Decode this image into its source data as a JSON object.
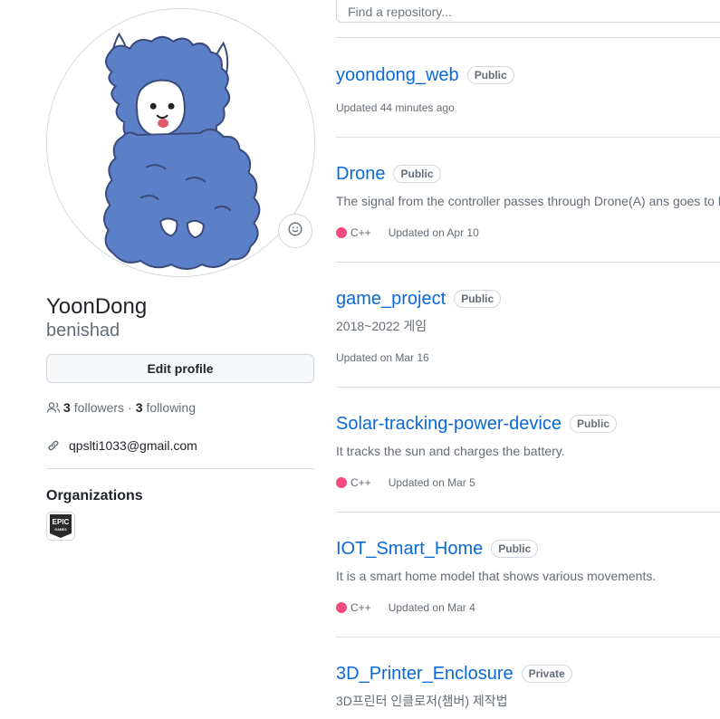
{
  "profile": {
    "display_name": "YoonDong",
    "username": "benishad",
    "edit_label": "Edit profile",
    "followers_count": "3",
    "followers_label": "followers",
    "separator": "·",
    "following_count": "3",
    "following_label": "following",
    "email": "qpslti1033@gmail.com",
    "organizations_heading": "Organizations",
    "organizations": [
      {
        "name": "Epic Games",
        "logo_line1": "EPIC",
        "logo_line2": "GAMES"
      }
    ]
  },
  "search": {
    "placeholder": "Find a repository..."
  },
  "repos": [
    {
      "name": "yoondong_web",
      "visibility": "Public",
      "description": "",
      "language": "",
      "lang_color": "",
      "updated": "Updated 44 minutes ago"
    },
    {
      "name": "Drone",
      "visibility": "Public",
      "description": "The signal from the controller passes through Drone(A) ans goes to D",
      "language": "C++",
      "lang_color": "#f34b7d",
      "updated": "Updated on Apr 10"
    },
    {
      "name": "game_project",
      "visibility": "Public",
      "description": "2018~2022 게임",
      "language": "",
      "lang_color": "",
      "updated": "Updated on Mar 16"
    },
    {
      "name": "Solar-tracking-power-device",
      "visibility": "Public",
      "description": "It tracks the sun and charges the battery.",
      "language": "C++",
      "lang_color": "#f34b7d",
      "updated": "Updated on Mar 5"
    },
    {
      "name": "IOT_Smart_Home",
      "visibility": "Public",
      "description": "It is a smart home model that shows various movements.",
      "language": "C++",
      "lang_color": "#f34b7d",
      "updated": "Updated on Mar 4"
    },
    {
      "name": "3D_Printer_Enclosure",
      "visibility": "Private",
      "description": "3D프린터 인클로저(챔버) 제작법",
      "language": "",
      "lang_color": "",
      "updated": ""
    }
  ],
  "colors": {
    "link": "#0969da",
    "muted": "#656d76",
    "border": "#d0d7de",
    "avatar_fill": "#5b80c8"
  },
  "icons": {
    "status": "smiley-icon",
    "followers": "people-icon",
    "email": "link-icon"
  }
}
